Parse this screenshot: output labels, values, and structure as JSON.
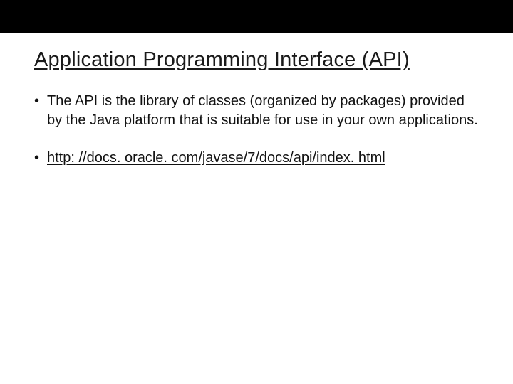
{
  "slide": {
    "title": "Application Programming Interface (API)",
    "bullets": [
      {
        "text": "The API is the library of classes (organized by packages) provided by the Java platform that is suitable for use in your own applications.",
        "underline": false
      },
      {
        "text": "http: //docs. oracle. com/javase/7/docs/api/index. html",
        "underline": true
      }
    ]
  }
}
